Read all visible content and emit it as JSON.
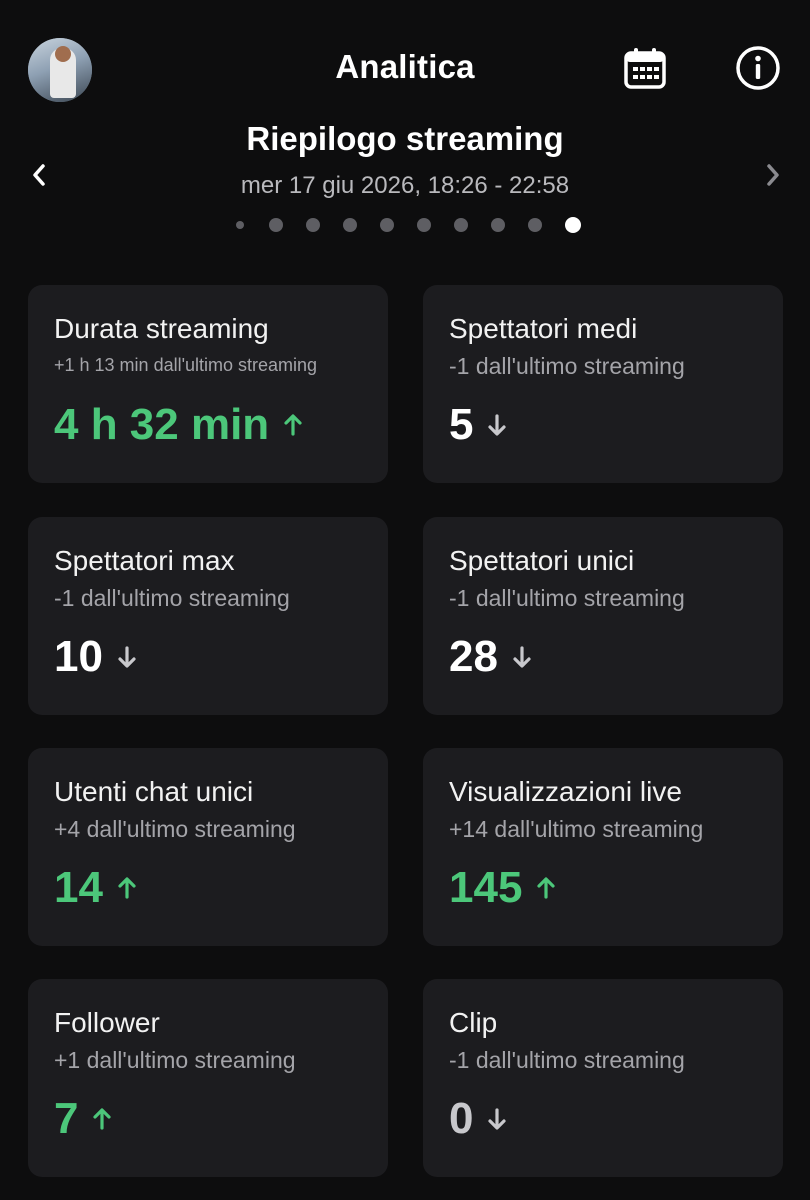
{
  "header": {
    "title": "Analitica",
    "subtitle": "Riepilogo streaming",
    "date_range": "mer 17 giu 2026, 18:26 - 22:58",
    "pager": {
      "total": 10,
      "active_index": 9
    }
  },
  "icons": {
    "calendar": "calendar-icon",
    "info": "info-icon",
    "prev": "chevron-left-icon",
    "next": "chevron-right-icon"
  },
  "colors": {
    "positive": "#4cc77a",
    "card_bg": "#1c1c1f",
    "background": "#0d0d0e"
  },
  "cards": [
    {
      "label": "Durata streaming",
      "delta": "+1 h 13 min dall'ultimo streaming",
      "value": "4 h 32 min",
      "trend": "up"
    },
    {
      "label": "Spettatori medi",
      "delta": "-1 dall'ultimo streaming",
      "value": "5",
      "trend": "down"
    },
    {
      "label": "Spettatori max",
      "delta": "-1 dall'ultimo streaming",
      "value": "10",
      "trend": "down"
    },
    {
      "label": "Spettatori unici",
      "delta": "-1 dall'ultimo streaming",
      "value": "28",
      "trend": "down"
    },
    {
      "label": "Utenti chat unici",
      "delta": "+4 dall'ultimo streaming",
      "value": "14",
      "trend": "up"
    },
    {
      "label": "Visualizzazioni live",
      "delta": "+14 dall'ultimo streaming",
      "value": "145",
      "trend": "up"
    },
    {
      "label": "Follower",
      "delta": "+1 dall'ultimo streaming",
      "value": "7",
      "trend": "up"
    },
    {
      "label": "Clip",
      "delta": "-1 dall'ultimo streaming",
      "value": "0",
      "trend": "down"
    }
  ]
}
